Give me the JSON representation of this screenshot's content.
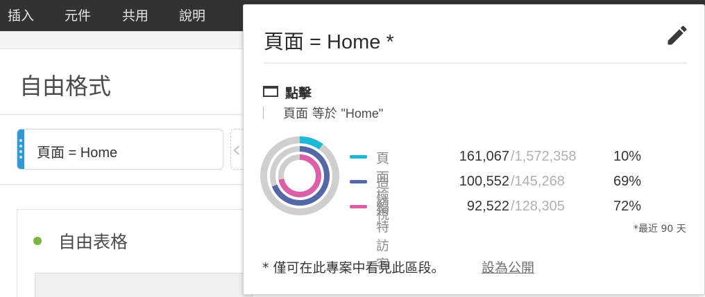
{
  "menu": [
    "插入",
    "元件",
    "共用",
    "說明"
  ],
  "workspace": {
    "title": "自由格式",
    "segment_chip": "頁面 = Home",
    "table_title": "自由表格"
  },
  "popover": {
    "title": "頁面 = Home *",
    "edit_icon": "pencil-icon",
    "container": {
      "icon": "container-icon",
      "label": "點擊",
      "rule_field": "頁面",
      "rule_operator": "等於",
      "rule_value": "\"Home\""
    },
    "metrics": [
      {
        "label": "頁面檢視",
        "value": "161,067",
        "total": "/1,572,358",
        "pct": "10%",
        "ratio": 0.1,
        "color": "#1fb8d6"
      },
      {
        "label": "造訪",
        "value": "100,552",
        "total": "/145,268",
        "pct": "69%",
        "ratio": 0.69,
        "color": "#5468a8"
      },
      {
        "label": "獨特訪客",
        "value": "92,522",
        "total": "/128,305",
        "pct": "72%",
        "ratio": 0.72,
        "color": "#dd5fa8"
      }
    ],
    "recent_note": "*最近 90 天",
    "footer_note": "* 僅可在此專案中看見此區段。",
    "footer_link": "設為公開"
  }
}
